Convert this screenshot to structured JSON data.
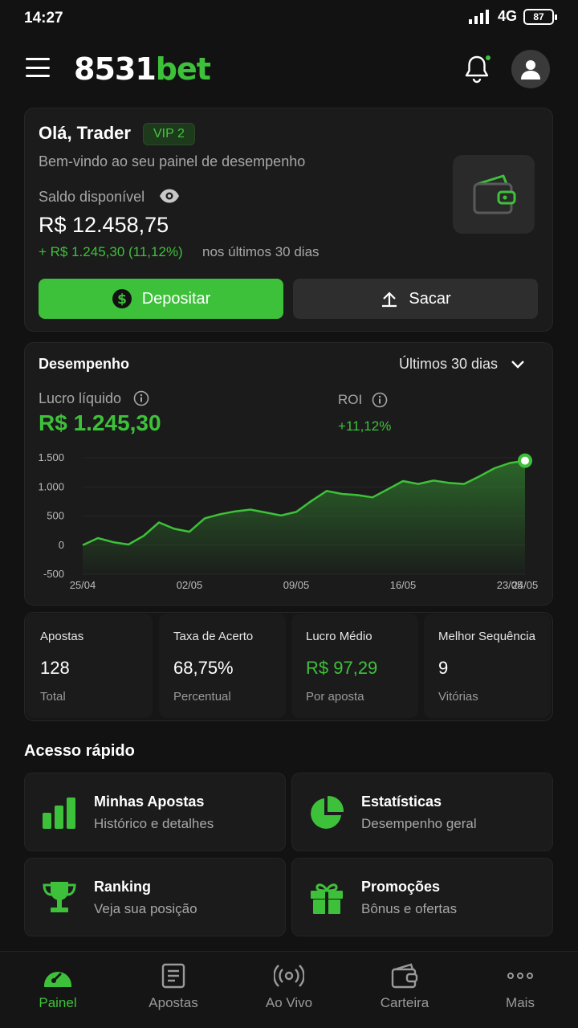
{
  "status": {
    "time": "14:27",
    "network": "4G",
    "battery": "87"
  },
  "header": {
    "logo_white": "8531",
    "logo_green": "bet"
  },
  "account": {
    "greeting": "Olá, Trader",
    "vip": "VIP 2",
    "welcome": "Bem-vindo ao seu painel de desempenho",
    "balance_label": "Saldo disponível",
    "balance": "R$ 12.458,75",
    "change": "+ R$ 1.245,30 (11,12%)",
    "change_period": "nos últimos 30 dias",
    "deposit_label": "Depositar",
    "withdraw_label": "Sacar"
  },
  "performance": {
    "title": "Desempenho",
    "period": "Últimos 30 dias",
    "profit_label": "Lucro líquido",
    "profit": "R$ 1.245,30",
    "roi_label": "ROI",
    "roi": "+11,12%"
  },
  "chart_data": {
    "type": "area",
    "x": [
      "25/04",
      "26/04",
      "27/04",
      "28/04",
      "29/04",
      "30/04",
      "01/05",
      "02/05",
      "03/05",
      "04/05",
      "05/05",
      "06/05",
      "07/05",
      "08/05",
      "09/05",
      "10/05",
      "11/05",
      "12/05",
      "13/05",
      "14/05",
      "15/05",
      "16/05",
      "17/05",
      "18/05",
      "19/05",
      "20/05",
      "21/05",
      "22/05",
      "23/05",
      "24/05"
    ],
    "values": [
      0,
      120,
      50,
      10,
      160,
      390,
      280,
      230,
      460,
      530,
      580,
      610,
      560,
      510,
      570,
      760,
      930,
      880,
      860,
      820,
      960,
      1100,
      1050,
      1110,
      1070,
      1050,
      1180,
      1320,
      1410,
      1450
    ],
    "x_ticks": [
      "25/04",
      "02/05",
      "09/05",
      "16/05",
      "23/05",
      "24/05"
    ],
    "y_ticks": [
      "1.500",
      "1.000",
      "500",
      "0",
      "-500"
    ],
    "ylim": [
      -500,
      1500
    ],
    "line_color": "#3ec13a",
    "grid": true
  },
  "stats": [
    {
      "title": "Apostas",
      "value": "128",
      "sub": "Total"
    },
    {
      "title": "Taxa de Acerto",
      "value": "68,75%",
      "sub": "Percentual"
    },
    {
      "title": "Lucro Médio",
      "value": "R$ 97,29",
      "sub": "Por aposta"
    },
    {
      "title": "Melhor Sequência",
      "value": "9",
      "sub": "Vitórias"
    }
  ],
  "quick_access": {
    "title": "Acesso rápido",
    "items": [
      {
        "title": "Minhas Apostas",
        "sub": "Histórico e detalhes",
        "icon": "bar-chart-icon"
      },
      {
        "title": "Estatísticas",
        "sub": "Desempenho geral",
        "icon": "pie-chart-icon"
      },
      {
        "title": "Ranking",
        "sub": "Veja sua posição",
        "icon": "trophy-icon"
      },
      {
        "title": "Promoções",
        "sub": "Bônus e ofertas",
        "icon": "gift-icon"
      }
    ]
  },
  "nav": [
    {
      "label": "Painel",
      "icon": "dashboard-icon",
      "active": true
    },
    {
      "label": "Apostas",
      "icon": "document-icon"
    },
    {
      "label": "Ao Vivo",
      "icon": "live-broadcast-icon"
    },
    {
      "label": "Carteira",
      "icon": "wallet-icon"
    },
    {
      "label": "Mais",
      "icon": "more-dots-icon"
    }
  ],
  "colors": {
    "accent": "#3ec13a",
    "background": "#121212",
    "card": "#1b1b1b"
  }
}
